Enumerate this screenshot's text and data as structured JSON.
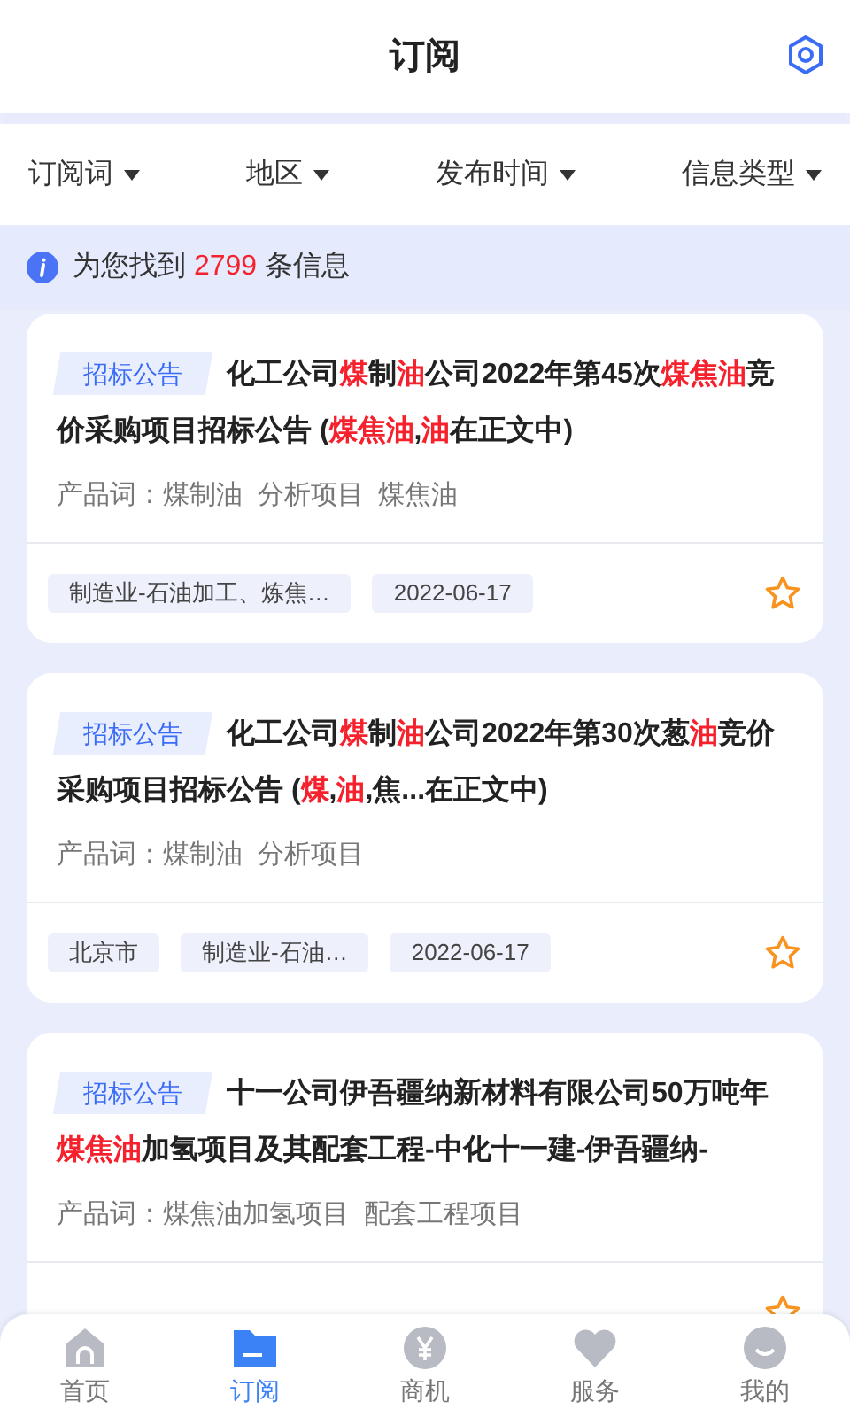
{
  "header": {
    "title": "订阅"
  },
  "filters": [
    {
      "label": "订阅词"
    },
    {
      "label": "地区"
    },
    {
      "label": "发布时间"
    },
    {
      "label": "信息类型"
    }
  ],
  "result_bar": {
    "prefix": "为您找到",
    "count": "2799",
    "suffix": "条信息"
  },
  "cards": [
    {
      "badge": "招标公告",
      "title": [
        {
          "text": "化工公司",
          "highlight": false
        },
        {
          "text": "煤",
          "highlight": true
        },
        {
          "text": "制",
          "highlight": false
        },
        {
          "text": "油",
          "highlight": true
        },
        {
          "text": "公司2022年第45次",
          "highlight": false
        },
        {
          "text": "煤焦油",
          "highlight": true
        },
        {
          "text": "竞价采购项目招标公告 (",
          "highlight": false
        },
        {
          "text": "煤焦油",
          "highlight": true
        },
        {
          "text": ",",
          "highlight": false
        },
        {
          "text": "油",
          "highlight": true
        },
        {
          "text": "在正文中)",
          "highlight": false
        }
      ],
      "products": "产品词：煤制油  分析项目  煤焦油",
      "tags": [
        "制造业-石油加工、炼焦…",
        "2022-06-17"
      ],
      "starred": false
    },
    {
      "badge": "招标公告",
      "title": [
        {
          "text": "化工公司",
          "highlight": false
        },
        {
          "text": "煤",
          "highlight": true
        },
        {
          "text": "制",
          "highlight": false
        },
        {
          "text": "油",
          "highlight": true
        },
        {
          "text": "公司2022年第30次葱",
          "highlight": false
        },
        {
          "text": "油",
          "highlight": true
        },
        {
          "text": "竞价采购项目招标公告 (",
          "highlight": false
        },
        {
          "text": "煤",
          "highlight": true
        },
        {
          "text": ",",
          "highlight": false
        },
        {
          "text": "油",
          "highlight": true
        },
        {
          "text": ",焦...在正文中)",
          "highlight": false
        }
      ],
      "products": "产品词：煤制油  分析项目",
      "tags": [
        "北京市",
        "制造业-石油…",
        "2022-06-17"
      ],
      "starred": false
    },
    {
      "badge": "招标公告",
      "title": [
        {
          "text": "十一公司伊吾疆纳新材料有限公司50万吨年",
          "highlight": false
        },
        {
          "text": "煤焦油",
          "highlight": true
        },
        {
          "text": "加氢项目及其配套工程-中化十一建-伊吾疆纳-",
          "highlight": false
        }
      ],
      "products": "产品词：煤焦油加氢项目  配套工程项目",
      "starred": false
    }
  ],
  "tabbar": [
    {
      "label": "首页",
      "kind": "home",
      "selected": false
    },
    {
      "label": "订阅",
      "kind": "folder",
      "selected": true
    },
    {
      "label": "商机",
      "kind": "yen",
      "selected": false
    },
    {
      "label": "服务",
      "kind": "heart",
      "selected": false
    },
    {
      "label": "我的",
      "kind": "face",
      "selected": false
    }
  ]
}
